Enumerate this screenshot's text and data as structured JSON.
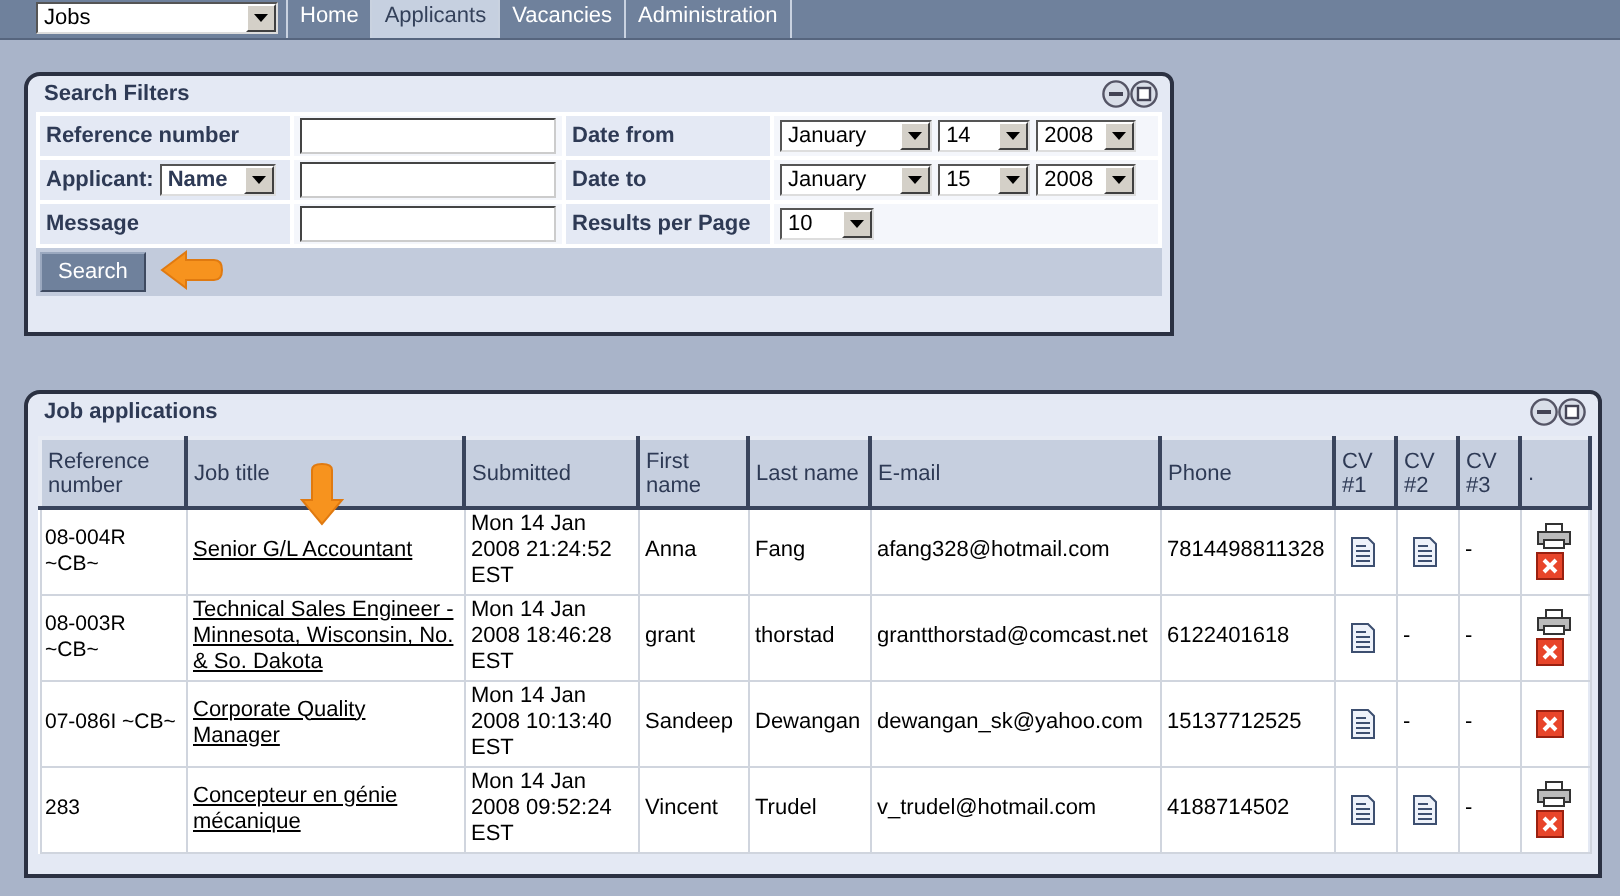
{
  "app_select": {
    "value": "Jobs"
  },
  "nav_tabs": [
    {
      "label": "Home",
      "selected": false
    },
    {
      "label": "Applicants",
      "selected": true
    },
    {
      "label": "Vacancies",
      "selected": false
    },
    {
      "label": "Administration",
      "selected": false
    }
  ],
  "search_filters": {
    "title": "Search Filters",
    "left": [
      {
        "label": "Reference number"
      },
      {
        "label": "Applicant:",
        "select": "Name"
      },
      {
        "label": "Message"
      }
    ],
    "right": [
      {
        "label": "Date from",
        "selects": [
          "January",
          "14",
          "2008"
        ]
      },
      {
        "label": "Date to",
        "selects": [
          "January",
          "15",
          "2008"
        ]
      },
      {
        "label": "Results per Page",
        "selects": [
          "10"
        ]
      }
    ],
    "search_button": "Search"
  },
  "job_applications": {
    "title": "Job applications",
    "columns": [
      "Reference number",
      "Job title",
      "Submitted",
      "First name",
      "Last name",
      "E-mail",
      "Phone",
      "CV #1",
      "CV #2",
      "CV #3",
      "."
    ],
    "rows": [
      {
        "reference": "08-004R ~CB~",
        "job_title": "Senior G/L Accountant",
        "submitted": "Mon 14 Jan 2008 21:24:52 EST",
        "first_name": "Anna",
        "last_name": "Fang",
        "email": "afang328@hotmail.com",
        "phone": "7814498811328",
        "cv": [
          {
            "kind": "document"
          },
          {
            "kind": "document"
          },
          {
            "kind": "none",
            "text": "-"
          }
        ],
        "printable": true
      },
      {
        "reference": "08-003R ~CB~",
        "job_title": "Technical Sales Engineer - Minnesota, Wisconsin, No. & So. Dakota",
        "submitted": "Mon 14 Jan 2008 18:46:28 EST",
        "first_name": "grant",
        "last_name": "thorstad",
        "email": "grantthorstad@comcast.net",
        "phone": "6122401618",
        "cv": [
          {
            "kind": "document"
          },
          {
            "kind": "none",
            "text": "-"
          },
          {
            "kind": "none",
            "text": "-"
          }
        ],
        "printable": true
      },
      {
        "reference": "07-086I ~CB~",
        "job_title": "Corporate Quality Manager",
        "submitted": "Mon 14 Jan 2008 10:13:40 EST",
        "first_name": "Sandeep",
        "last_name": "Dewangan",
        "email": "dewangan_sk@yahoo.com",
        "phone": "15137712525",
        "cv": [
          {
            "kind": "document"
          },
          {
            "kind": "none",
            "text": "-"
          },
          {
            "kind": "none",
            "text": "-"
          }
        ],
        "printable": false
      },
      {
        "reference": "283",
        "job_title": "Concepteur en génie mécanique",
        "submitted": "Mon 14 Jan 2008 09:52:24 EST",
        "first_name": "Vincent",
        "last_name": "Trudel",
        "email": "v_trudel@hotmail.com",
        "phone": "4188714502",
        "cv": [
          {
            "kind": "document"
          },
          {
            "kind": "document"
          },
          {
            "kind": "none",
            "text": "-"
          }
        ],
        "printable": true
      }
    ]
  }
}
